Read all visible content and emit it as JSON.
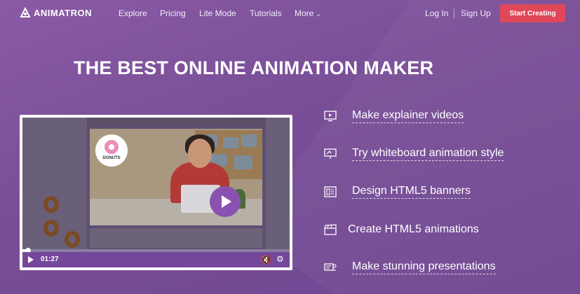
{
  "nav": {
    "logo_text": "ANIMATRON",
    "logo_icon": "animatron-logo-icon",
    "links": [
      "Explore",
      "Pricing",
      "Lite Mode",
      "Tutorials",
      "More"
    ],
    "more_icon": "chevron-down-icon",
    "login": "Log In",
    "signup": "Sign Up",
    "cta": "Start Creating"
  },
  "hero": {
    "title": "THE BEST ONLINE ANIMATION MAKER"
  },
  "video": {
    "badge_text": "DONUTS",
    "time": "01:27",
    "progress": 0.02,
    "play_icon": "play-icon",
    "volume_icon": "volume-icon",
    "settings_icon": "gear-icon"
  },
  "features": [
    {
      "label": "Make explainer videos",
      "icon": "video-screen-icon",
      "link": true
    },
    {
      "label": "Try whiteboard animation style",
      "icon": "whiteboard-icon",
      "link": true
    },
    {
      "label": "Design HTML5 banners",
      "icon": "banner-icon",
      "link": true
    },
    {
      "label": "Create HTML5 animations",
      "icon": "clapperboard-icon",
      "link": false
    },
    {
      "label": "Make stunning presentations",
      "icon": "presentation-icon",
      "link": true
    }
  ],
  "colors": {
    "background": "#7a4f98",
    "cta": "#e0485a",
    "play_button": "#8a52b0"
  }
}
